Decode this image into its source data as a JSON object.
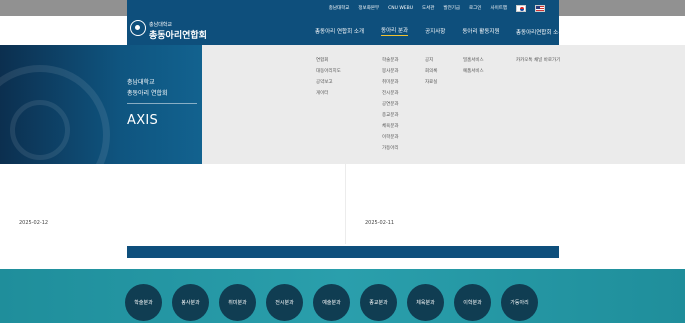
{
  "util": {
    "links": [
      "충남대학교",
      "정보화본부",
      "CNU WEBU",
      "도서관",
      "발전기금",
      "로그인",
      "사이트맵"
    ],
    "flags": [
      "korean-flag-icon",
      "us-flag-icon"
    ]
  },
  "header": {
    "logo_small": "충남대학교",
    "logo_big": "총동아리연합회",
    "nav": [
      "총동아리 연합회 소개",
      "동아리 분과",
      "공지사항",
      "동아리 활동지원",
      "총동아리연합회 소통"
    ],
    "active_index": 1
  },
  "mega": {
    "title_line1": "충남대학교",
    "title_line2": "총동아리 연합회",
    "axis": "AXIS",
    "cols": [
      [
        "연합회",
        "대동아리지도",
        "공약보고",
        "게이터"
      ],
      [
        "학술분과",
        "봉사분과",
        "취미분과",
        "전시분과",
        "공연분과",
        "종교분과",
        "체육분과",
        "이학분과",
        "가등아리"
      ],
      [
        "공지",
        "회의록",
        "자료실"
      ],
      [
        "밀홈서비스",
        "예품서비스"
      ],
      [
        "카카오톡 채널 바로가기"
      ]
    ]
  },
  "posts": [
    {
      "date": "2025-02-12"
    },
    {
      "date": "2025-02-11"
    }
  ],
  "footer": {
    "categories": [
      "학술분과",
      "봉사분과",
      "취미분과",
      "전시분과",
      "예술분과",
      "종교분과",
      "체육분과",
      "이학분과",
      "가등아리"
    ]
  },
  "colors": {
    "brand": "#0e4f7c",
    "accent": "#f2c230",
    "footer": "#2a9fac",
    "circle": "#103d52"
  }
}
